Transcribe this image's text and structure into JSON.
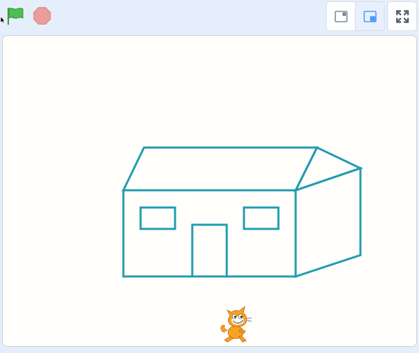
{
  "toolbar": {
    "green_flag": {
      "icon": "green-flag-icon",
      "color": "#4cbf56"
    },
    "stop": {
      "icon": "stop-icon",
      "color": "#ec9c9c"
    },
    "layout_buttons": [
      {
        "icon": "small-stage-icon",
        "active": false
      },
      {
        "icon": "normal-stage-icon",
        "active": true
      }
    ],
    "fullscreen": {
      "icon": "fullscreen-icon"
    }
  },
  "stage": {
    "background": "#fffefb",
    "pen_color": "#1f9cb0",
    "drawing": "house",
    "sprite": {
      "name": "cat-sprite",
      "costume": "Scratch Cat"
    }
  },
  "colors": {
    "workspace_bg": "#e5effc",
    "accent": "#4c97ff"
  }
}
